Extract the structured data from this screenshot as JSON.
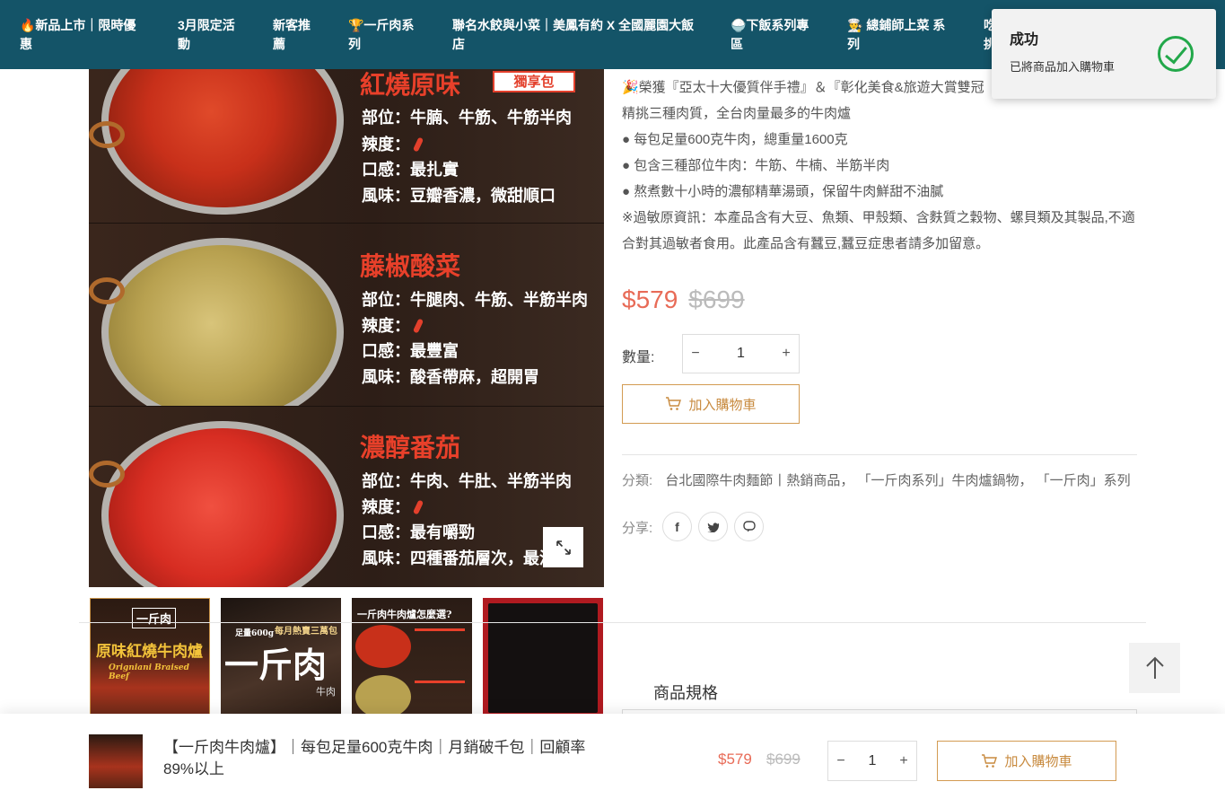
{
  "nav": {
    "items": [
      "🔥新品上市｜限時優惠",
      "3月限定活動",
      "新客推薦",
      "🏆一斤肉系列",
      "聯名水餃與小菜｜美鳳有約 X 全國麗園大飯店",
      "🍚下飯系列專區",
      "👨‍🍳 總鋪師上菜 系列",
      "吃貨挑"
    ]
  },
  "toast": {
    "title": "成功",
    "message": "已將商品加入購物車"
  },
  "image": {
    "flavors": [
      {
        "name": "紅燒原味",
        "badge": "獨享包",
        "part": "部位：牛腩、牛筋、牛筋半肉",
        "spicy": "辣度：",
        "texture": "口感：最扎實",
        "taste": "風味：豆瓣香濃，微甜順口"
      },
      {
        "name": "藤椒酸菜",
        "part": "部位：牛腿肉、牛筋、半筋半肉",
        "spicy": "辣度：",
        "texture": "口感：最豐富",
        "taste": "風味：酸香帶麻，超開胃"
      },
      {
        "name": "濃醇番茄",
        "part": "部位：牛肉、牛肚、半筋半肉",
        "spicy": "辣度：",
        "texture": "口感：最有嚼勁",
        "taste": "風味：四種番茄層次，最濃"
      }
    ],
    "thumbs": {
      "t1_brand": "一斤肉",
      "t1_title": "原味紅燒牛肉爐",
      "t1_sub": "Origniani Braised Beef",
      "t2_title": "一斤肉",
      "t2_sub": "每月熱賣三萬包",
      "t2_weight": "足量600g",
      "t2_tag": "牛肉",
      "t3_title": "一斤肉牛肉爐怎麼選?"
    }
  },
  "info": {
    "desc": [
      "🎉榮獲『亞太十大優質伴手禮』＆『彰化美食&旅遊大賞雙冠",
      "精挑三種肉質，全台肉量最多的牛肉爐",
      "● 每包足量600克牛肉，總重量1600克",
      "● 包含三種部位牛肉：牛筋、牛楠、半筋半肉",
      "● 熬煮數十小時的濃郁精華湯頭，保留牛肉鮮甜不油膩",
      "※過敏原資訊：本產品含有大豆、魚類、甲殼類、含麩質之穀物、螺貝類及其製品,不適合對其過敏者食用。此產品含有蠶豆,蠶豆症患者請多加留意。"
    ],
    "price": "$579",
    "original_price": "$699",
    "qty_label": "數量:",
    "qty": "1",
    "add_to_cart": "加入購物車",
    "category_label": "分類:",
    "categories": "台北國際牛肉麵節丨熱銷商品， 「一斤肉系列」牛肉爐鍋物， 「一斤肉」系列",
    "share_label": "分享:",
    "share_icons": [
      "facebook-icon",
      "twitter-icon",
      "line-icon"
    ]
  },
  "tabs": {
    "spec": "商品規格"
  },
  "sticky": {
    "title": "【一斤肉牛肉爐】｜每包足量600克牛肉｜月銷破千包｜回顧率89%以上",
    "price": "$579",
    "original_price": "$699",
    "qty": "1",
    "add_to_cart": "加入購物車"
  },
  "colors": {
    "nav_bg": "#145468",
    "sale_price": "#e86b57",
    "accent": "#d39b52",
    "success": "#22a84a"
  }
}
